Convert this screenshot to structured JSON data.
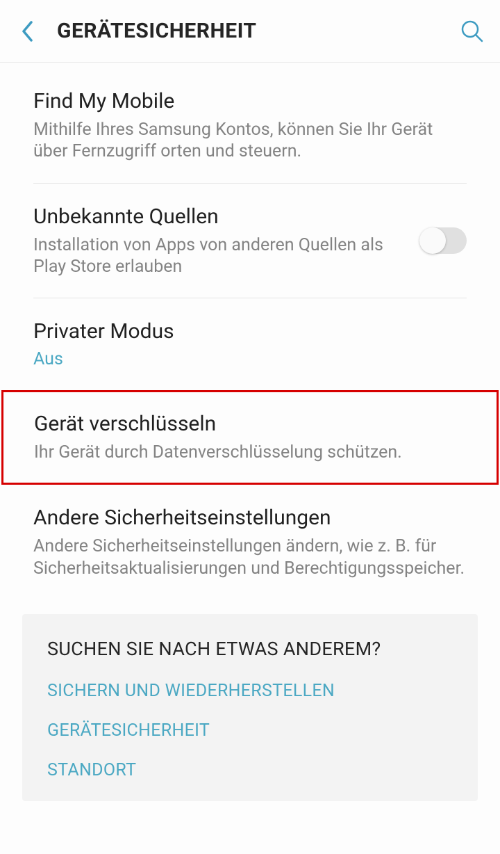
{
  "header": {
    "title": "GERÄTESICHERHEIT"
  },
  "items": {
    "findmymobile": {
      "title": "Find My Mobile",
      "desc": "Mithilfe Ihres Samsung Kontos, können Sie Ihr Gerät über Fernzugriff orten und steuern."
    },
    "unknown": {
      "title": "Unbekannte Quellen",
      "desc": "Installation von Apps von anderen Quellen als Play Store erlauben"
    },
    "privatemode": {
      "title": "Privater Modus",
      "status": "Aus"
    },
    "encrypt": {
      "title": "Gerät verschlüsseln",
      "desc": "Ihr Gerät durch Datenverschlüsselung schützen."
    },
    "other": {
      "title": "Andere Sicherheitseinstellungen",
      "desc": "Andere Sicherheitseinstellungen ändern, wie z. B. für Sicherheitsaktualisierungen und Berechtigungsspeicher."
    }
  },
  "related": {
    "title": "SUCHEN SIE NACH ETWAS ANDEREM?",
    "links": {
      "backup": "SICHERN UND WIEDERHERSTELLEN",
      "security": "GERÄTESICHERHEIT",
      "location": "STANDORT"
    }
  }
}
